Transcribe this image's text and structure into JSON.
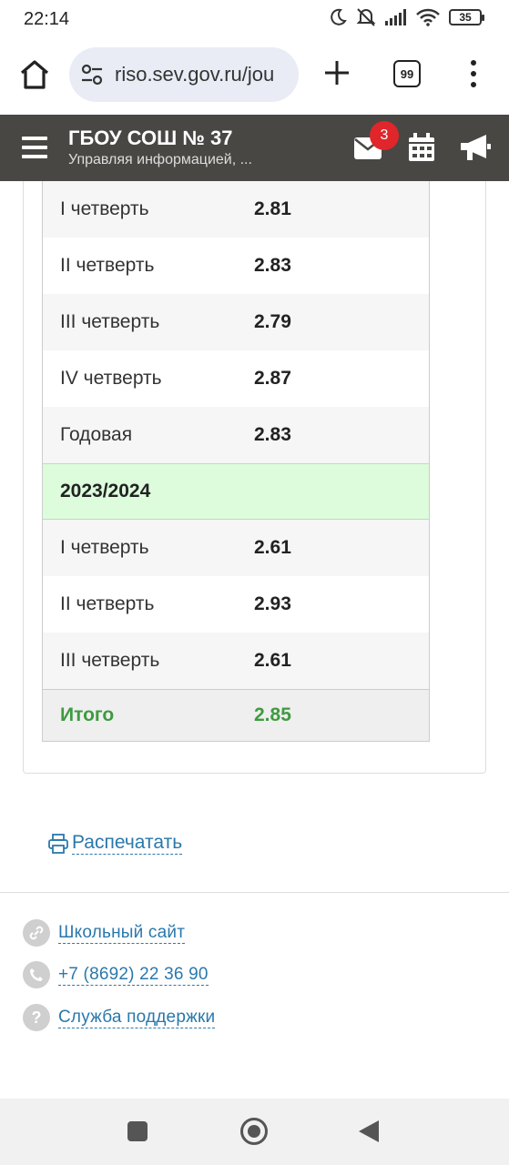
{
  "status_bar": {
    "time": "22:14",
    "battery": "35"
  },
  "browser": {
    "url": "riso.sev.gov.ru/jou",
    "tab_count": "99"
  },
  "header": {
    "title": "ГБОУ СОШ № 37",
    "subtitle": "Управляя информацией, ...",
    "mail_badge": "3"
  },
  "grades": {
    "rows_top": [
      {
        "label": "I четверть",
        "value": "2.81"
      },
      {
        "label": "II четверть",
        "value": "2.83"
      },
      {
        "label": "III четверть",
        "value": "2.79"
      },
      {
        "label": "IV четверть",
        "value": "2.87"
      },
      {
        "label": "Годовая",
        "value": "2.83"
      }
    ],
    "year": "2023/2024",
    "rows_bottom": [
      {
        "label": "I четверть",
        "value": "2.61"
      },
      {
        "label": "II четверть",
        "value": "2.93"
      },
      {
        "label": "III четверть",
        "value": "2.61"
      }
    ],
    "total": {
      "label": "Итого",
      "value": "2.85"
    }
  },
  "print_label": "Распечатать",
  "footer": {
    "site": "Школьный сайт",
    "phone": "+7 (8692) 22 36 90",
    "support": "Служба поддержки"
  },
  "colors": {
    "header_bg": "#484744",
    "link": "#2a78ac",
    "year_bg": "#dcfcdc",
    "total": "#3e9b3e",
    "badge": "#e0262b"
  }
}
